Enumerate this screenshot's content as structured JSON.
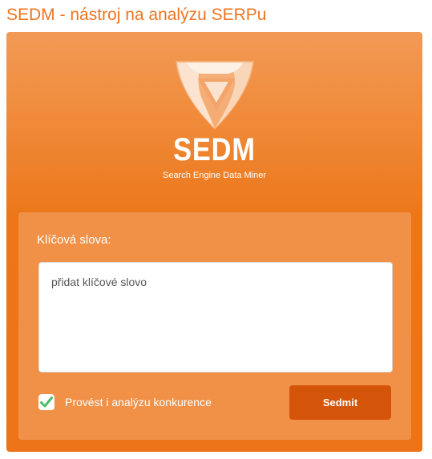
{
  "page": {
    "title": "SEDM - nástroj na analýzu SERPu"
  },
  "brand": {
    "name": "SEDM",
    "tagline": "Search Engine Data Miner",
    "logo_icon": "shield-triangle-logo"
  },
  "form": {
    "keywords_label": "Klíčová slova:",
    "keywords_placeholder": "přidat klíčové slovo",
    "keywords_value": "",
    "competition_checkbox": {
      "label": "Provést i analýzu konkurence",
      "checked": true,
      "check_icon": "check-icon"
    },
    "submit_label": "Sedmit"
  },
  "colors": {
    "title": "#ee7420",
    "card_top": "#f29a55",
    "card_bottom": "#ec7317",
    "panel": "#f19148",
    "button": "#d4550a",
    "check": "#4cbb6c"
  }
}
